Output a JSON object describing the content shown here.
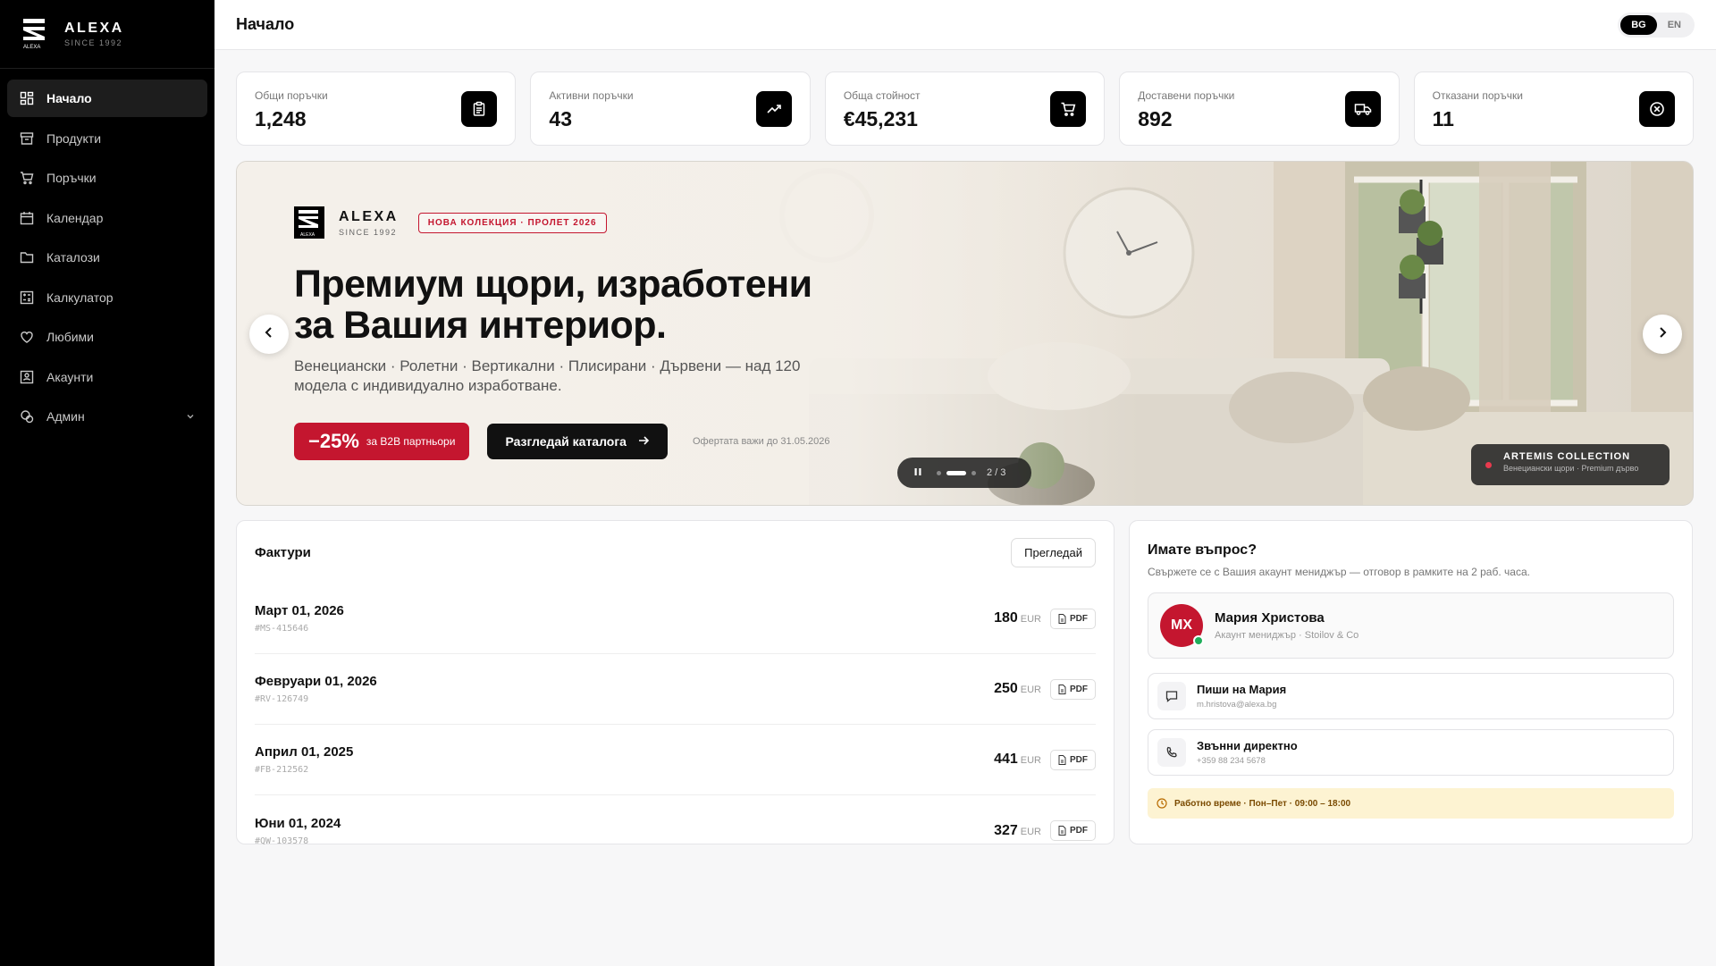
{
  "brand": {
    "name": "ALEXA",
    "since": "SINCE 1992",
    "mark_text": "ALEXA"
  },
  "sidebar": {
    "items": [
      {
        "label": "Начало",
        "icon": "dashboard-icon",
        "active": true
      },
      {
        "label": "Продукти",
        "icon": "box-icon"
      },
      {
        "label": "Поръчки",
        "icon": "cart-icon"
      },
      {
        "label": "Календар",
        "icon": "calendar-icon"
      },
      {
        "label": "Каталози",
        "icon": "folder-icon"
      },
      {
        "label": "Калкулатор",
        "icon": "calculator-icon"
      },
      {
        "label": "Любими",
        "icon": "heart-icon"
      },
      {
        "label": "Акаунти",
        "icon": "accounts-icon"
      },
      {
        "label": "Админ",
        "icon": "admin-icon",
        "has_submenu": true
      }
    ]
  },
  "header": {
    "title": "Начало",
    "languages": [
      "BG",
      "EN"
    ],
    "active_language": "BG"
  },
  "stats": [
    {
      "label": "Общи поръчки",
      "value": "1,248",
      "icon": "clipboard-icon"
    },
    {
      "label": "Активни поръчки",
      "value": "43",
      "icon": "trending-up-icon"
    },
    {
      "label": "Обща стойност",
      "value": "€45,231",
      "icon": "cart-icon"
    },
    {
      "label": "Доставени поръчки",
      "value": "892",
      "icon": "truck-icon"
    },
    {
      "label": "Отказани поръчки",
      "value": "11",
      "icon": "cancel-circle-icon"
    }
  ],
  "hero": {
    "brand_name": "ALEXA",
    "brand_since": "SINCE 1992",
    "badge": "НОВА КОЛЕКЦИЯ · ПРОЛЕТ 2026",
    "headline_1": "Премиум щори, изработени",
    "headline_2": "за Вашия интериор.",
    "subtitle": "Венециански · Ролетни · Вертикални · Плисирани · Дървени — над 120 модела с индивидуално изработване.",
    "promo_big": "−25%",
    "promo_small": "за B2B партньори",
    "cta": "Разгледай каталога",
    "offer_note": "Офертата важи до 31.05.2026",
    "slide_counter": "2 / 3",
    "collection_title": "ARTEMIS COLLECTION",
    "collection_sub": "Венециански щори · Premium дърво"
  },
  "invoices": {
    "title": "Фактури",
    "view_label": "Прегледай",
    "currency": "EUR",
    "pdf_label": "PDF",
    "rows": [
      {
        "date": "Март 01, 2026",
        "number": "#MS-415646",
        "amount": "180"
      },
      {
        "date": "Февруари 01, 2026",
        "number": "#RV-126749",
        "amount": "250"
      },
      {
        "date": "Април 01, 2025",
        "number": "#FB-212562",
        "amount": "441"
      },
      {
        "date": "Юни 01, 2024",
        "number": "#QW-103578",
        "amount": "327"
      }
    ]
  },
  "support": {
    "title": "Имате въпрос?",
    "subtitle": "Свържете се с Вашия акаунт мениджър — отговор в рамките на 2 раб. часа.",
    "manager_initials": "МХ",
    "manager_name": "Мария Христова",
    "manager_role": "Акаунт мениджър · Stoilov & Co",
    "write_label": "Пиши на Мария",
    "write_email": "m.hristova@alexa.bg",
    "call_label": "Звънни директно",
    "call_phone": "+359 88 234 5678",
    "hours": "Работно време · Пон–Пет · 09:00 – 18:00"
  },
  "colors": {
    "accent": "#c4162f",
    "sidebar_bg": "#000000",
    "hours_bg": "#fdf3d2",
    "online": "#1fae5b"
  }
}
